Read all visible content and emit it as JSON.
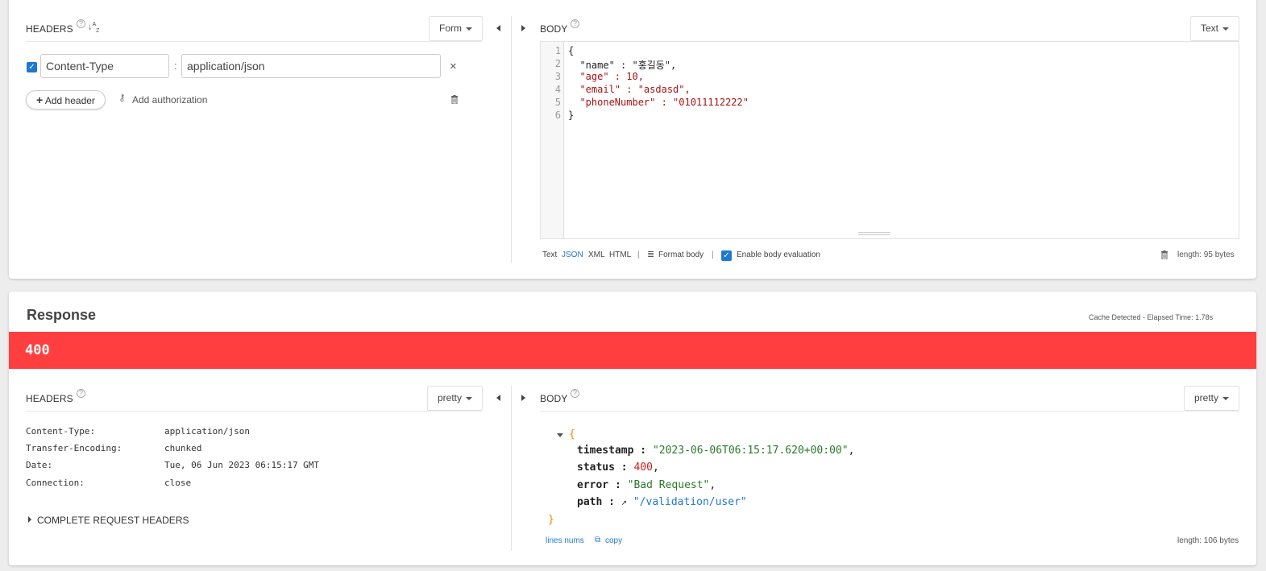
{
  "request": {
    "headers": {
      "title": "HEADERS",
      "mode_label": "Form",
      "rows": [
        {
          "enabled": true,
          "name": "Content-Type",
          "separator": ":",
          "value": "application/json"
        }
      ],
      "add_header_label": "Add header",
      "add_authorization_label": "Add authorization"
    },
    "body": {
      "title": "BODY",
      "mode_label": "Text",
      "line_numbers": [
        "1",
        "2",
        "3",
        "4",
        "5",
        "6"
      ],
      "lines": [
        "{",
        "  \"name\" : \"홍길동\",",
        "  \"age\" : 10,",
        "  \"email\" : \"asdasd\",",
        "  \"phoneNumber\" : \"01011112222\"",
        "}"
      ],
      "formats": [
        "Text",
        "JSON",
        "XML",
        "HTML"
      ],
      "active_format": "JSON",
      "separator": "|",
      "format_body_label": "Format body",
      "enable_eval_label": "Enable body evaluation",
      "length_label": "length: 95 bytes"
    }
  },
  "response": {
    "title": "Response",
    "meta": "Cache Detected - Elapsed Time: 1.78s",
    "status_code": "400",
    "status_color": "#ff3f3f",
    "headers": {
      "title": "HEADERS",
      "mode_label": "pretty",
      "rows": [
        {
          "name": "Content-Type:",
          "value": "application/json"
        },
        {
          "name": "Transfer-Encoding:",
          "value": "chunked"
        },
        {
          "name": "Date:",
          "value": "Tue, 06 Jun 2023 06:15:17 GMT"
        },
        {
          "name": "Connection:",
          "value": "close"
        }
      ],
      "complete_label": "COMPLETE REQUEST HEADERS"
    },
    "body": {
      "title": "BODY",
      "mode_label": "pretty",
      "open_brace": "{",
      "close_brace": "}",
      "fields": [
        {
          "key": "timestamp",
          "value": "\"2023-06-06T06:15:17.620+00:00\"",
          "type": "string"
        },
        {
          "key": "status",
          "value": "400",
          "type": "number"
        },
        {
          "key": "error",
          "value": "\"Bad Request\"",
          "type": "string"
        },
        {
          "key": "path",
          "value": "\"/validation/user\"",
          "type": "link"
        }
      ],
      "lines_nums_label": "lines nums",
      "copy_label": "copy",
      "length_label": "length: 106 bytes"
    }
  },
  "colors": {
    "accent": "#1f78d1",
    "error": "#ff3f3f",
    "brace": "#f08c00"
  }
}
